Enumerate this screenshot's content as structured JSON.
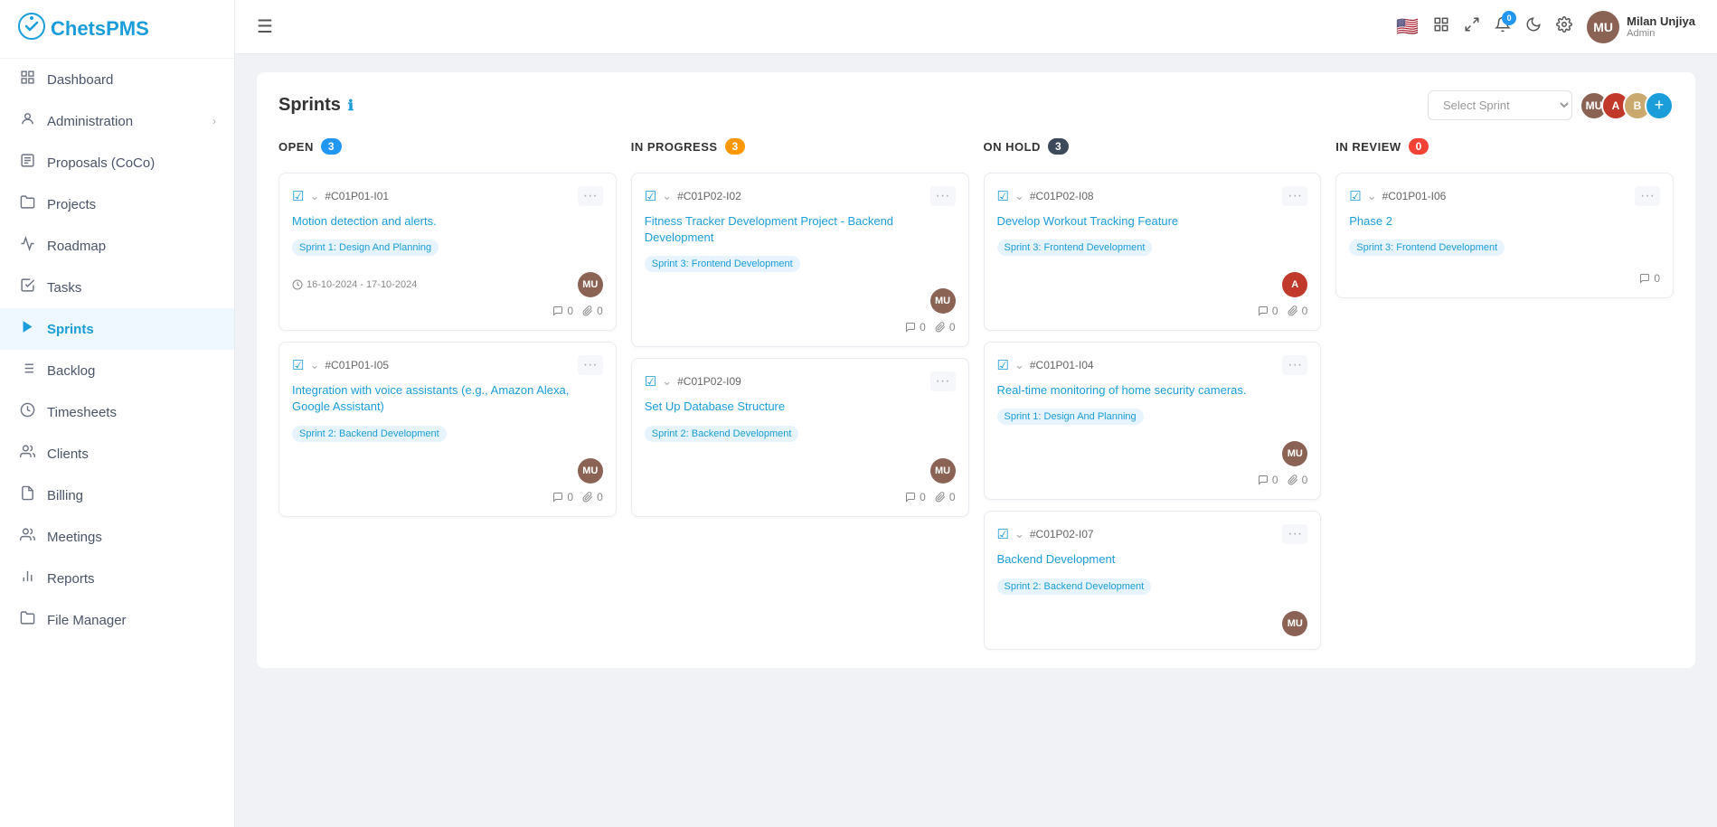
{
  "app": {
    "name": "ChetsPMS"
  },
  "sidebar": {
    "items": [
      {
        "label": "Dashboard",
        "icon": "📊",
        "active": false,
        "id": "dashboard"
      },
      {
        "label": "Administration",
        "icon": "👤",
        "active": false,
        "id": "administration",
        "hasChevron": true
      },
      {
        "label": "Proposals (CoCo)",
        "icon": "📋",
        "active": false,
        "id": "proposals"
      },
      {
        "label": "Projects",
        "icon": "📁",
        "active": false,
        "id": "projects"
      },
      {
        "label": "Roadmap",
        "icon": "📈",
        "active": false,
        "id": "roadmap"
      },
      {
        "label": "Tasks",
        "icon": "☑",
        "active": false,
        "id": "tasks"
      },
      {
        "label": "Sprints",
        "icon": "▶",
        "active": true,
        "id": "sprints"
      },
      {
        "label": "Backlog",
        "icon": "≡",
        "active": false,
        "id": "backlog"
      },
      {
        "label": "Timesheets",
        "icon": "⏱",
        "active": false,
        "id": "timesheets"
      },
      {
        "label": "Clients",
        "icon": "👥",
        "active": false,
        "id": "clients"
      },
      {
        "label": "Billing",
        "icon": "📄",
        "active": false,
        "id": "billing"
      },
      {
        "label": "Meetings",
        "icon": "👥",
        "active": false,
        "id": "meetings"
      },
      {
        "label": "Reports",
        "icon": "📊",
        "active": false,
        "id": "reports"
      },
      {
        "label": "File Manager",
        "icon": "📁",
        "active": false,
        "id": "file-manager"
      }
    ]
  },
  "topbar": {
    "hamburger": "☰",
    "flag": "🇺🇸",
    "notification_count": "0",
    "user": {
      "name": "Milan Unjiya",
      "role": "Admin"
    }
  },
  "sprints": {
    "title": "Sprints",
    "select_placeholder": "Select Sprint",
    "columns": [
      {
        "id": "open",
        "label": "OPEN",
        "badge": "3",
        "badge_color": "badge-blue",
        "cards": [
          {
            "id": "#C01P01-I01",
            "title": "Motion detection and alerts.",
            "sprint_tag": "Sprint 1: Design And Planning",
            "date": "16-10-2024 - 17-10-2024",
            "comments": "0",
            "attachments": "0",
            "avatar_color": "av-brown"
          },
          {
            "id": "#C01P01-I05",
            "title": "Integration with voice assistants (e.g., Amazon Alexa, Google Assistant)",
            "sprint_tag": "Sprint 2: Backend Development",
            "date": "",
            "comments": "0",
            "attachments": "0",
            "avatar_color": "av-brown"
          }
        ]
      },
      {
        "id": "in-progress",
        "label": "IN PROGRESS",
        "badge": "3",
        "badge_color": "badge-orange",
        "cards": [
          {
            "id": "#C01P02-I02",
            "title": "Fitness Tracker Development Project - Backend Development",
            "sprint_tag": "Sprint 3: Frontend Development",
            "date": "",
            "comments": "0",
            "attachments": "0",
            "avatar_color": "av-brown"
          },
          {
            "id": "#C01P02-I09",
            "title": "Set Up Database Structure",
            "sprint_tag": "Sprint 2: Backend Development",
            "date": "",
            "comments": "0",
            "attachments": "0",
            "avatar_color": "av-brown"
          }
        ]
      },
      {
        "id": "on-hold",
        "label": "ON HOLD",
        "badge": "3",
        "badge_color": "badge-dark",
        "cards": [
          {
            "id": "#C01P02-I08",
            "title": "Develop Workout Tracking Feature",
            "sprint_tag": "Sprint 3: Frontend Development",
            "date": "",
            "comments": "0",
            "attachments": "0",
            "avatar_color": "av-red"
          },
          {
            "id": "#C01P01-I04",
            "title": "Real-time monitoring of home security cameras.",
            "sprint_tag": "Sprint 1: Design And Planning",
            "date": "",
            "comments": "0",
            "attachments": "0",
            "avatar_color": "av-brown"
          },
          {
            "id": "#C01P02-I07",
            "title": "Backend Development",
            "sprint_tag": "Sprint 2: Backend Development",
            "date": "",
            "comments": "",
            "attachments": "",
            "avatar_color": "av-brown"
          }
        ]
      },
      {
        "id": "in-review",
        "label": "IN REVIEW",
        "badge": "0",
        "badge_color": "badge-red",
        "cards": [
          {
            "id": "#C01P01-I06",
            "title": "Phase 2",
            "sprint_tag": "Sprint 3: Frontend Development",
            "date": "",
            "comments": "0",
            "attachments": "",
            "avatar_color": "av-brown"
          }
        ]
      }
    ]
  }
}
